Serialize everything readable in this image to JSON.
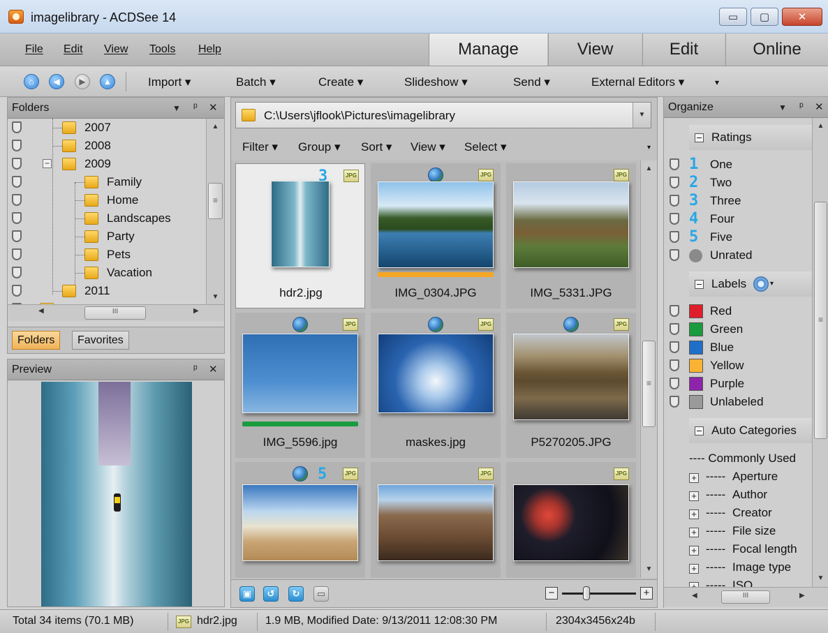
{
  "window": {
    "title": "imagelibrary - ACDSee 14",
    "min_glyph": "▭",
    "max_glyph": "▢",
    "close_glyph": "✕"
  },
  "menu": [
    "File",
    "Edit",
    "View",
    "Tools",
    "Help"
  ],
  "mode_tabs": [
    "Manage",
    "View",
    "Edit",
    "Online"
  ],
  "toolbar": {
    "nav": {
      "home": "⌂",
      "back": "◀",
      "forward": "▶",
      "up": "▲"
    },
    "items": [
      "Import ▾",
      "Batch ▾",
      "Create ▾",
      "Slideshow ▾",
      "Send ▾",
      "External Editors ▾"
    ],
    "overflow": "▾"
  },
  "folders_panel": {
    "title": "Folders",
    "controls": [
      "▼",
      "ᵖ",
      "✕"
    ],
    "tree": [
      {
        "label": "2007"
      },
      {
        "label": "2008"
      },
      {
        "label": "2009",
        "expander": "−"
      },
      {
        "label": "Family"
      },
      {
        "label": "Home"
      },
      {
        "label": "Landscapes"
      },
      {
        "label": "Party"
      },
      {
        "label": "Pets"
      },
      {
        "label": "Vacation"
      },
      {
        "label": "2011"
      }
    ],
    "tabs": [
      "Folders",
      "Favorites"
    ],
    "hscroll_thumb": "III",
    "vscroll_thumb": "≡"
  },
  "preview_panel": {
    "title": "Preview",
    "controls": [
      "ᵖ",
      "✕"
    ]
  },
  "browser": {
    "path": "C:\\Users\\jflook\\Pictures\\imagelibrary",
    "filters": [
      "Filter ▾",
      "Group ▾",
      "Sort ▾",
      "View ▾",
      "Select ▾"
    ],
    "jpg_badge": "JPG",
    "scroll_thumb": "≡",
    "thumbnails": [
      {
        "name": "hdr2.jpg",
        "rating": "3",
        "selected": true
      },
      {
        "name": "IMG_0304.JPG",
        "label_color": "#f5a623"
      },
      {
        "name": "IMG_5331.JPG"
      },
      {
        "name": "IMG_5596.jpg",
        "label_color": "#1a9c3e"
      },
      {
        "name": "maskes.jpg"
      },
      {
        "name": "P5270205.JPG"
      },
      {
        "name": ""
      },
      {
        "name": ""
      },
      {
        "name": ""
      }
    ],
    "row3_rating": "5",
    "bottom_icons": {
      "a": "▣",
      "b": "↺",
      "c": "↻",
      "d": "▭"
    },
    "zoom": {
      "minus": "−",
      "plus": "+",
      "level": 0.3
    }
  },
  "organize_panel": {
    "title": "Organize",
    "controls": [
      "▼",
      "ᵖ",
      "✕"
    ],
    "ratings_title": "Ratings",
    "ratings": [
      {
        "num": "1",
        "label": "One"
      },
      {
        "num": "2",
        "label": "Two"
      },
      {
        "num": "3",
        "label": "Three"
      },
      {
        "num": "4",
        "label": "Four"
      },
      {
        "num": "5",
        "label": "Five"
      }
    ],
    "unrated": "Unrated",
    "labels_title": "Labels",
    "labels": [
      {
        "label": "Red",
        "color": "#e01e2b"
      },
      {
        "label": "Green",
        "color": "#1a9c3e"
      },
      {
        "label": "Blue",
        "color": "#1f6fc9"
      },
      {
        "label": "Yellow",
        "color": "#f9b233"
      },
      {
        "label": "Purple",
        "color": "#8e24aa"
      },
      {
        "label": "Unlabeled",
        "color": "#9a9a9a"
      }
    ],
    "auto_title": "Auto Categories",
    "commonly_used": "---- Commonly Used",
    "categories": [
      "Aperture",
      "Author",
      "Creator",
      "File size",
      "Focal length",
      "Image type",
      "ISO"
    ],
    "cat_prefix": "----- ",
    "hscroll_thumb": "III"
  },
  "status": {
    "total": "Total 34 items  (70.1 MB)",
    "file": "hdr2.jpg",
    "details": "1.9 MB, Modified Date: 9/13/2011 12:08:30 PM",
    "dims": "2304x3456x24b"
  }
}
